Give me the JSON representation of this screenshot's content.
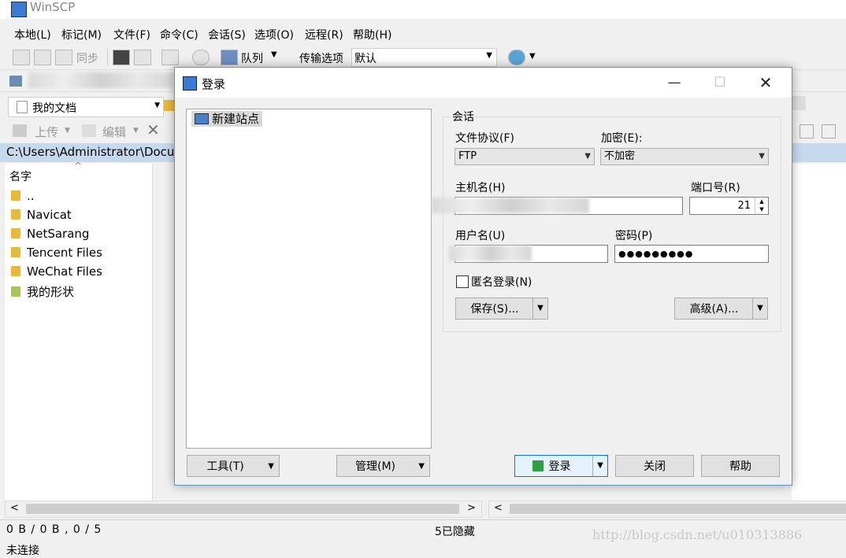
{
  "app": {
    "title": "WinSCP"
  },
  "menu": [
    "本地(L)",
    "标记(M)",
    "文件(F)",
    "命令(C)",
    "会话(S)",
    "选项(O)",
    "远程(R)",
    "帮助(H)"
  ],
  "toolbar": {
    "sync_label": "同步",
    "queue_label": "队列",
    "transfer_label": "传输选项",
    "transfer_value": "默认"
  },
  "local_panel": {
    "location": "我的文档",
    "upload_label": "上传",
    "edit_label": "编辑",
    "path": "C:\\Users\\Administrator\\Docu",
    "column_name": "名字",
    "items": [
      "..",
      "Navicat",
      "NetSarang",
      "Tencent Files",
      "WeChat Files",
      "我的形状"
    ]
  },
  "status": {
    "left": "0 B / 0 B , 0 / 5",
    "hidden": "5已隐藏",
    "connection": "未连接"
  },
  "dialog": {
    "title": "登录",
    "site": "新建站点",
    "session_label": "会话",
    "protocol_label": "文件协议(F)",
    "protocol_value": "FTP",
    "encryption_label": "加密(E):",
    "encryption_value": "不加密",
    "host_label": "主机名(H)",
    "port_label": "端口号(R)",
    "port_value": "21",
    "user_label": "用户名(U)",
    "password_label": "密码(P)",
    "password_value": "●●●●●●●●●",
    "anonymous_label": "匿名登录(N)",
    "save_label": "保存(S)...",
    "advanced_label": "高级(A)...",
    "tools_label": "工具(T)",
    "manage_label": "管理(M)",
    "login_label": "登录",
    "close_label": "关闭",
    "help_label": "帮助"
  },
  "watermark": "http://blog.csdn.net/u010313886"
}
